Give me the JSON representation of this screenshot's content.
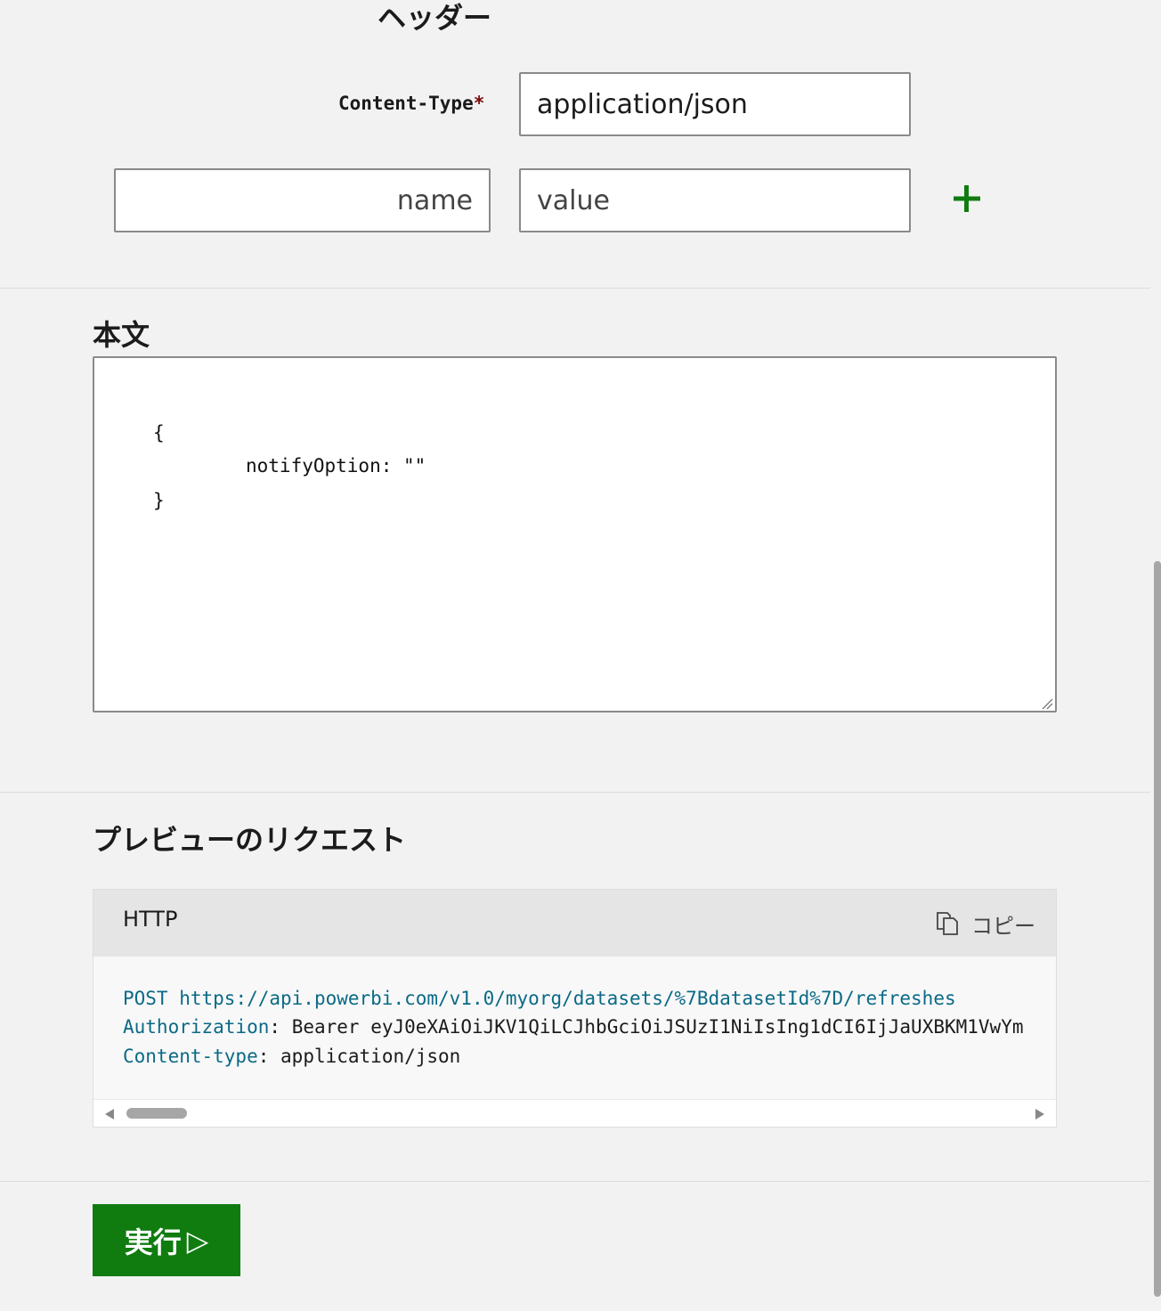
{
  "headers": {
    "title": "ヘッダー",
    "content_type_label": "Content-Type",
    "required_mark": "*",
    "content_type_value": "application/json",
    "name_placeholder": "name",
    "value_placeholder": "value",
    "add_icon": "plus-icon"
  },
  "body": {
    "title": "本文",
    "lines": [
      "{",
      "notifyOption: \"\"",
      "}"
    ]
  },
  "preview": {
    "title": "プレビューのリクエスト",
    "tab": "HTTP",
    "copy_label": "コピー",
    "copy_icon": "copy-icon",
    "method": "POST",
    "url": "https://api.powerbi.com/v1.0/myorg/datasets/%7BdatasetId%7D/refreshes",
    "auth_key": "Authorization",
    "auth_sep": ":",
    "auth_value": "Bearer eyJ0eXAiOiJKV1QiLCJhbGciOiJSUzI1NiIsIng1dCI6IjJaUXBKM1VwYm",
    "ct_key": "Content-type",
    "ct_sep": ":",
    "ct_value": "application/json"
  },
  "actions": {
    "run_label": "実行",
    "run_icon": "▷"
  },
  "colors": {
    "accent": "#107c10",
    "code_keyword": "#0b6a86",
    "required": "#7a0b0b"
  }
}
